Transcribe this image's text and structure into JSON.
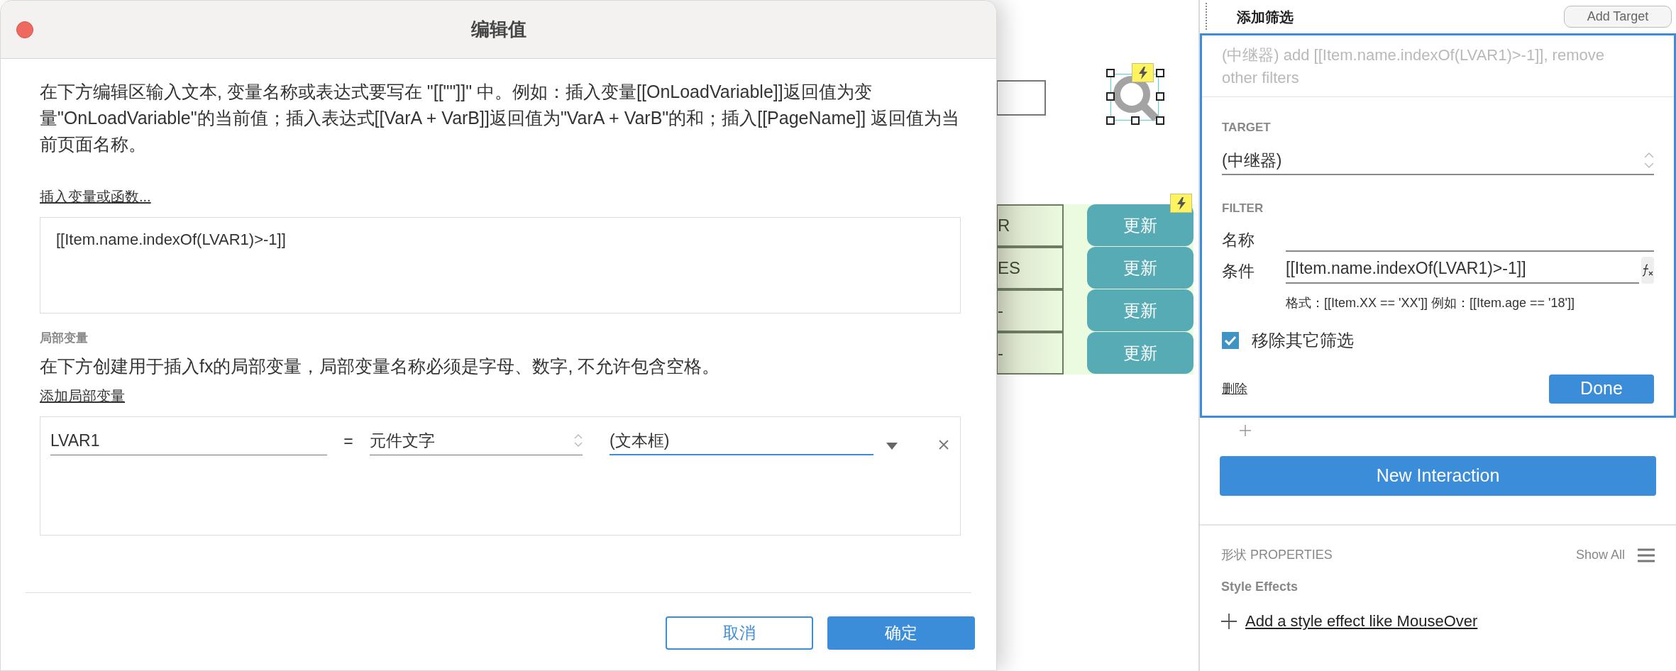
{
  "dialog": {
    "title": "编辑值",
    "instructions": "在下方编辑区输入文本, 变量名称或表达式要写在 \"[[\"\"]]\" 中。例如：插入变量[[OnLoadVariable]]返回值为变量\"OnLoadVariable\"的当前值；插入表达式[[VarA + VarB]]返回值为\"VarA + VarB\"的和；插入[[PageName]] 返回值为当前页面名称。",
    "insert_link": "插入变量或函数...",
    "expression_value": "[[Item.name.indexOf(LVAR1)>-1]]",
    "local_vars_heading": "局部变量",
    "local_vars_note": "在下方创建用于插入fx的局部变量，局部变量名称必须是字母、数字, 不允许包含空格。",
    "add_local_var_link": "添加局部变量",
    "local_vars": [
      {
        "name": "LVAR1",
        "equals": "=",
        "source": "元件文字",
        "target": "(文本框)"
      }
    ],
    "buttons": [
      {
        "label": "取消",
        "kind": "secondary"
      },
      {
        "label": "确定",
        "kind": "primary"
      }
    ]
  },
  "canvas": {
    "table_rows": [
      {
        "cell": "R",
        "button": "更新",
        "badge": true
      },
      {
        "cell": "ES",
        "button": "更新",
        "badge": false
      },
      {
        "cell": "-",
        "button": "更新",
        "badge": false
      },
      {
        "cell": "-",
        "button": "更新",
        "badge": false
      }
    ]
  },
  "panel": {
    "section_title": "添加筛选",
    "add_target": "Add Target",
    "summary": "(中继器) add [[Item.name.indexOf(LVAR1)>-1]], remove other filters",
    "target_label": "TARGET",
    "target_value": "(中继器)",
    "filter_label": "FILTER",
    "name_label": "名称",
    "condition_label": "条件",
    "condition_value": "[[Item.name.indexOf(LVAR1)>-1]]",
    "hint": "格式：[[Item.XX == 'XX']] 例如：[[Item.age == '18']]",
    "remove_others": {
      "label": "移除其它筛选",
      "checked": true
    },
    "delete_link": "删除",
    "done": "Done",
    "new_interaction": "New Interaction",
    "properties_title": "形状 PROPERTIES",
    "show_all": "Show All",
    "style_effects": "Style Effects",
    "add_effect": "Add a style effect like MouseOver"
  }
}
